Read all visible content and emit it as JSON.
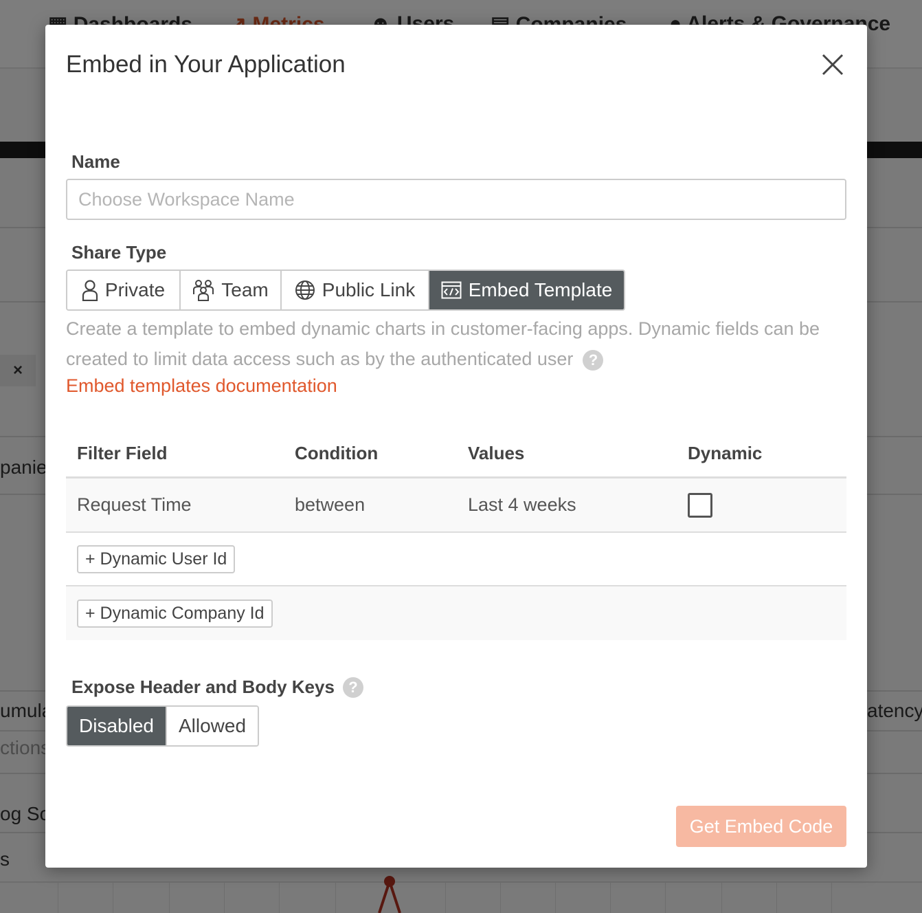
{
  "background": {
    "nav": [
      "Dashboards",
      "Metrics",
      "Users",
      "Companies",
      "Alerts & Governance"
    ],
    "fragments": [
      "panie",
      "umula",
      "ctions",
      "og Sc",
      "s",
      "atency"
    ]
  },
  "modal": {
    "title": "Embed in Your Application",
    "name_label": "Name",
    "name_placeholder": "Choose Workspace Name",
    "share_type_label": "Share Type",
    "share_types": [
      {
        "label": "Private",
        "icon": "person-icon",
        "active": false
      },
      {
        "label": "Team",
        "icon": "team-icon",
        "active": false
      },
      {
        "label": "Public Link",
        "icon": "globe-icon",
        "active": false
      },
      {
        "label": "Embed Template",
        "icon": "embed-code-icon",
        "active": true
      }
    ],
    "description": "Create a template to embed dynamic charts in customer-facing apps. Dynamic fields can be created to limit data access such as by the authenticated user",
    "docs_link": "Embed templates documentation",
    "table": {
      "headers": [
        "Filter Field",
        "Condition",
        "Values",
        "Dynamic"
      ],
      "rows": [
        {
          "field": "Request Time",
          "condition": "between",
          "values": "Last 4 weeks",
          "dynamic": false
        }
      ],
      "add_user_btn": "+ Dynamic User Id",
      "add_company_btn": "+ Dynamic Company Id"
    },
    "expose_label": "Expose Header and Body Keys",
    "expose_options": [
      {
        "label": "Disabled",
        "active": true
      },
      {
        "label": "Allowed",
        "active": false
      }
    ],
    "submit_label": "Get Embed Code",
    "colors": {
      "accent": "#e0582c",
      "active_segment": "#555b5e",
      "submit_disabled": "#f7b9a2"
    }
  }
}
